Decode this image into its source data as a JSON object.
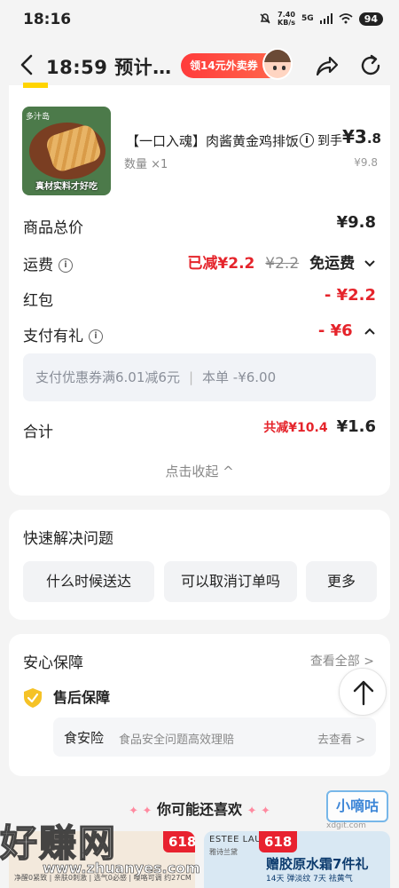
{
  "status_bar": {
    "time": "18:16",
    "net_speed_value": "7.40",
    "net_speed_unit": "KB/s",
    "signal": "5G",
    "battery": "94"
  },
  "nav": {
    "title": "18:59 预计…",
    "coupon_label": "领14元外卖券"
  },
  "order": {
    "product_brand": "多汁岛",
    "product_caption": "真材实料才好吃",
    "product_name": "【一口入魂】肉酱黄金鸡排饭",
    "arrive_label": "到手",
    "arrive_price_int": "¥3",
    "arrive_price_dec": ".8",
    "quantity": "数量 ×1",
    "original_price": "¥9.8",
    "goods_total_label": "商品总价",
    "goods_total_value": "¥9.8",
    "shipping_label": "运费",
    "shipping_reduced": "已减¥2.2",
    "shipping_original": "¥2.2",
    "shipping_free": "免运费",
    "redpacket_label": "红包",
    "redpacket_value": "- ¥2.2",
    "pay_gift_label": "支付有礼",
    "pay_gift_value": "- ¥6",
    "pay_box_left": "支付优惠券满6.01减6元",
    "pay_box_sep": "|",
    "pay_box_right": "本单 -¥6.00",
    "total_label": "合计",
    "total_reduced": "共减¥10.4",
    "total_value": "¥1.6",
    "collapse_label": "点击收起 ^"
  },
  "quick": {
    "title": "快速解决问题",
    "buttons": [
      "什么时候送达",
      "可以取消订单吗",
      "更多"
    ]
  },
  "safety": {
    "title": "安心保障",
    "see_all": "查看全部 >",
    "after_sale": "售后保障",
    "food_title": "食安险",
    "food_desc": "食品安全问题高效理赔",
    "food_link": "去查看 >"
  },
  "recommend": {
    "title": "你可能还喜欢",
    "left_tag": "618",
    "left_sub": "净醒0紧致 | 亲肤0刺激 | 选气0必感 | 嗓咯可调 约27CM",
    "right_tag": "618",
    "right_brand": "ESTEE LAUDER",
    "right_brand_cn": "雅诗兰黛",
    "right_headline": "赠胶原水霜7件礼",
    "right_sub": "14天 弹淡纹 7天 祛黄气"
  },
  "watermarks": {
    "big": "好赚网",
    "url": "www.zhuanyes.com",
    "small": "小嘀咕",
    "small_url": "xdgit.com"
  },
  "colors": {
    "accent_red": "#e5242b",
    "coupon_gradient_start": "#ff3b3b",
    "shield_yellow": "#f5c227"
  },
  "icons": [
    "back-icon",
    "share-icon",
    "refresh-icon",
    "info-icon",
    "chevron-down-icon",
    "chevron-up-icon",
    "shield-check-icon",
    "arrow-up-icon"
  ]
}
